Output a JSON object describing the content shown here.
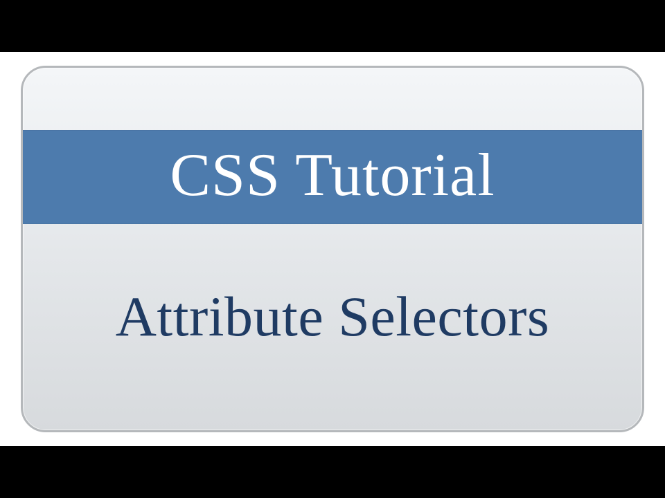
{
  "slide": {
    "banner_title": "CSS Tutorial",
    "subtitle": "Attribute Selectors"
  }
}
